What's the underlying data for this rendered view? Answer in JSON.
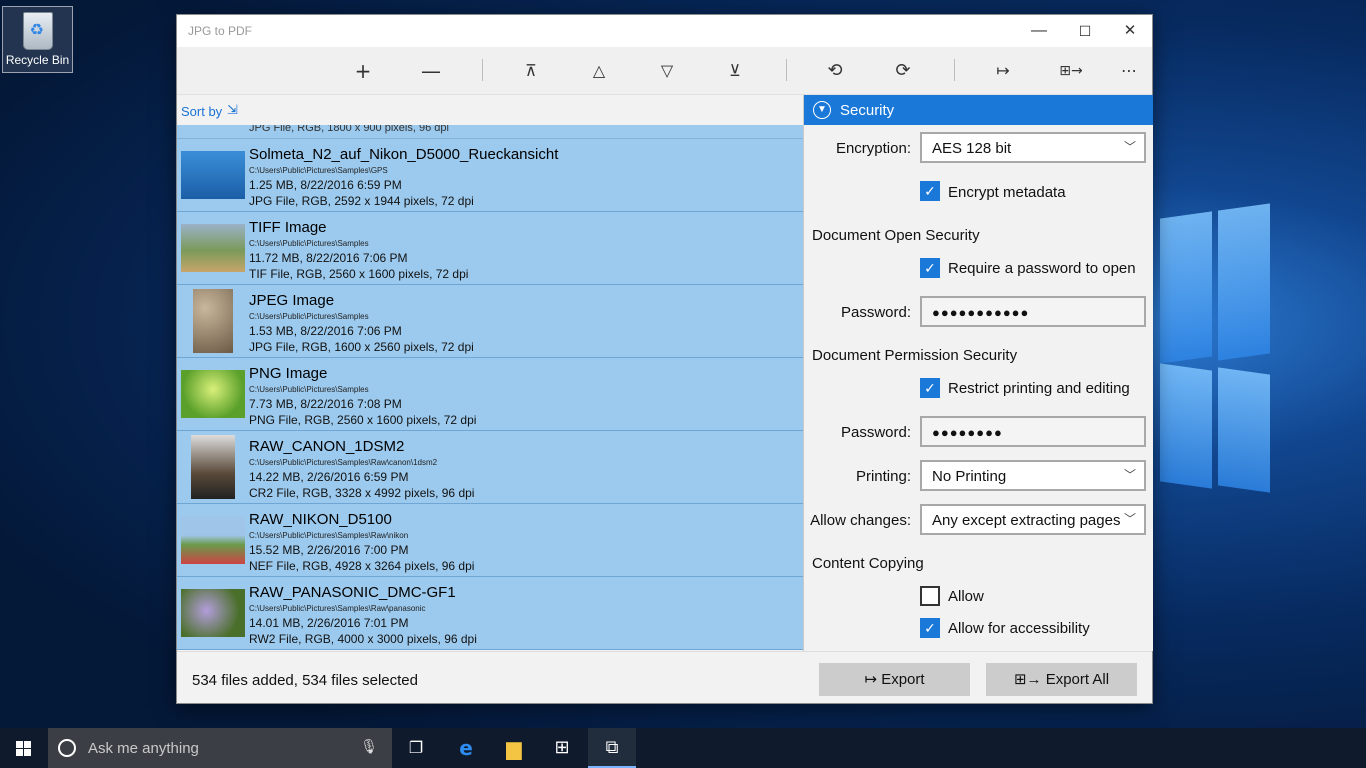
{
  "desktop": {
    "recycle_bin_label": "Recycle Bin"
  },
  "window": {
    "title": "JPG to PDF",
    "controls": {
      "minimize": "—",
      "maximize": "☐",
      "close": "✕"
    }
  },
  "toolbar": {
    "icons": [
      "plus-icon",
      "minus-icon",
      "move-to-top-icon",
      "move-up-icon",
      "move-down-icon",
      "move-to-bottom-icon",
      "rotate-left-icon",
      "rotate-right-icon",
      "export-icon",
      "export-all-icon",
      "more-icon"
    ]
  },
  "list": {
    "sort_label": "Sort by",
    "partial_row_text": "JPG File, RGB, 1800 x 900 pixels, 96 dpi",
    "items": [
      {
        "name": "Solmeta_N2_auf_Nikon_D5000_Rueckansicht",
        "path": "C:\\Users\\Public\\Pictures\\Samples\\GPS",
        "size_date": "1.25 MB, 8/22/2016 6:59 PM",
        "info": "JPG File, RGB, 2592 x 1944 pixels, 72 dpi",
        "thumb": "camera"
      },
      {
        "name": "TIFF Image",
        "path": "C:\\Users\\Public\\Pictures\\Samples",
        "size_date": "11.72 MB, 8/22/2016 7:06 PM",
        "info": "TIF File, RGB, 2560 x 1600 pixels, 72 dpi",
        "thumb": "painting"
      },
      {
        "name": "JPEG Image",
        "path": "C:\\Users\\Public\\Pictures\\Samples",
        "size_date": "1.53 MB, 8/22/2016 7:06 PM",
        "info": "JPG File, RGB, 1600 x 2560 pixels, 72 dpi",
        "thumb": "stones"
      },
      {
        "name": "PNG Image",
        "path": "C:\\Users\\Public\\Pictures\\Samples",
        "size_date": "7.73 MB, 8/22/2016 7:08 PM",
        "info": "PNG File, RGB, 2560 x 1600 pixels, 72 dpi",
        "thumb": "leaves"
      },
      {
        "name": "RAW_CANON_1DSM2",
        "path": "C:\\Users\\Public\\Pictures\\Samples\\Raw\\canon\\1dsm2",
        "size_date": "14.22 MB, 2/26/2016 6:59 PM",
        "info": "CR2 File, RGB, 3328 x 4992 pixels, 96 dpi",
        "thumb": "cameras"
      },
      {
        "name": "RAW_NIKON_D5100",
        "path": "C:\\Users\\Public\\Pictures\\Samples\\Raw\\nikon",
        "size_date": "15.52 MB, 2/26/2016 7:00 PM",
        "info": "NEF File, RGB, 4928 x 3264 pixels, 96 dpi",
        "thumb": "house"
      },
      {
        "name": "RAW_PANASONIC_DMC-GF1",
        "path": "C:\\Users\\Public\\Pictures\\Samples\\Raw\\panasonic",
        "size_date": "14.01 MB, 2/26/2016 7:01 PM",
        "info": "RW2 File, RGB, 4000 x 3000 pixels, 96 dpi",
        "thumb": "flowers"
      }
    ]
  },
  "security": {
    "header": "Security",
    "encryption_label": "Encryption:",
    "encryption_value": "AES 128 bit",
    "encrypt_metadata_label": "Encrypt metadata",
    "encrypt_metadata_checked": true,
    "open_title": "Document Open Security",
    "require_password_label": "Require a password to open",
    "require_password_checked": true,
    "password_label": "Password:",
    "open_password_mask": "●●●●●●●●●●●",
    "permission_title": "Document Permission Security",
    "restrict_label": "Restrict printing and editing",
    "restrict_checked": true,
    "perm_password_label": "Password:",
    "perm_password_mask": "●●●●●●●●",
    "printing_label": "Printing:",
    "printing_value": "No Printing",
    "changes_label": "Allow changes:",
    "changes_value": "Any except extracting pages",
    "copying_title": "Content Copying",
    "allow_label": "Allow",
    "allow_checked": false,
    "accessibility_label": "Allow for accessibility",
    "accessibility_checked": true
  },
  "status": {
    "text": "534 files added, 534 files selected",
    "export_label": "Export",
    "export_all_label": "Export All"
  },
  "taskbar": {
    "search_placeholder": "Ask me anything",
    "icons": [
      "start-icon",
      "cortana-icon",
      "microphone-icon",
      "task-view-icon",
      "edge-icon",
      "file-explorer-icon",
      "store-icon",
      "jpg-to-pdf-app-icon"
    ]
  }
}
